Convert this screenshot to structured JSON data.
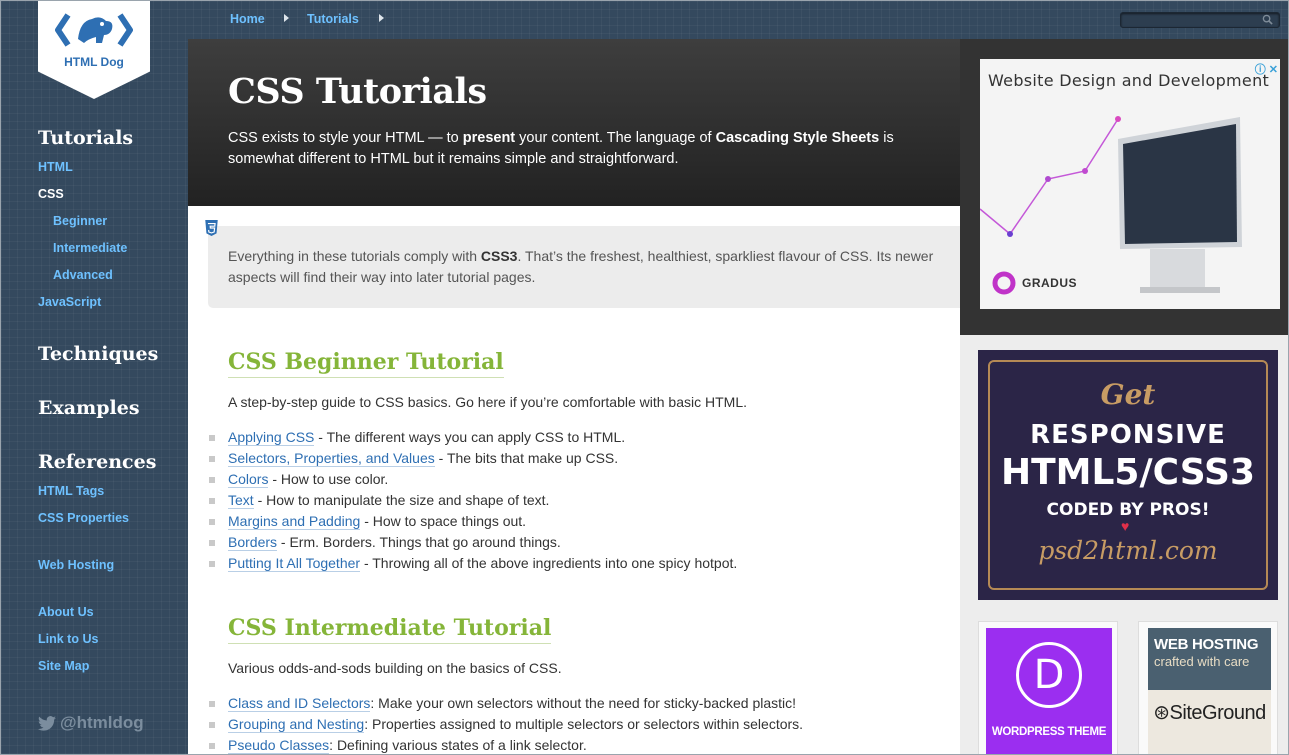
{
  "logo": {
    "text": "HTML Dog"
  },
  "sidebar": {
    "tutorials_heading": "Tutorials",
    "tutorial_links": [
      {
        "label": "HTML"
      },
      {
        "label": "CSS"
      },
      {
        "label": "Beginner"
      },
      {
        "label": "Intermediate"
      },
      {
        "label": "Advanced"
      },
      {
        "label": "JavaScript"
      }
    ],
    "techniques_heading": "Techniques",
    "examples_heading": "Examples",
    "references_heading": "References",
    "reference_links": [
      {
        "label": "HTML Tags"
      },
      {
        "label": "CSS Properties"
      }
    ],
    "web_hosting": "Web Hosting",
    "footer_links": [
      {
        "label": "About Us"
      },
      {
        "label": "Link to Us"
      },
      {
        "label": "Site Map"
      }
    ],
    "twitter": "@htmldog"
  },
  "breadcrumb": {
    "items": [
      "Home",
      "Tutorials"
    ]
  },
  "hero": {
    "title": "CSS Tutorials",
    "desc_1": "CSS exists to style your HTML — to ",
    "desc_b1": "present",
    "desc_2": " your content. The language of ",
    "desc_b2": "Cascading Style Sheets",
    "desc_3": " is somewhat different to HTML but it remains simple and straightforward."
  },
  "notice": {
    "t1": "Everything in these tutorials comply with ",
    "b1": "CSS3",
    "t2": ". That’s the freshest, healthiest, sparkliest flavour of CSS. Its newer aspects will find their way into later tutorial pages."
  },
  "beginner": {
    "title": "CSS Beginner Tutorial",
    "desc": "A step-by-step guide to CSS basics. Go here if you’re comfortable with basic HTML.",
    "items": [
      {
        "link": "Applying CSS",
        "text": " - The different ways you can apply CSS to HTML."
      },
      {
        "link": "Selectors, Properties, and Values",
        "text": " - The bits that make up CSS."
      },
      {
        "link": "Colors",
        "text": " - How to use color."
      },
      {
        "link": "Text",
        "text": " - How to manipulate the size and shape of text."
      },
      {
        "link": "Margins and Padding",
        "text": " - How to space things out."
      },
      {
        "link": "Borders",
        "text": " - Erm. Borders. Things that go around things."
      },
      {
        "link": "Putting It All Together",
        "text": " - Throwing all of the above ingredients into one spicy hotpot."
      }
    ]
  },
  "intermediate": {
    "title": "CSS Intermediate Tutorial",
    "desc": "Various odds-and-sods building on the basics of CSS.",
    "items": [
      {
        "link": "Class and ID Selectors",
        "text": ": Make your own selectors without the need for sticky-backed plastic!"
      },
      {
        "link": "Grouping and Nesting",
        "text": ": Properties assigned to multiple selectors or selectors within selectors."
      },
      {
        "link": "Pseudo Classes",
        "text": ": Defining various states of a link selector."
      }
    ]
  },
  "ads": {
    "ad1_title": "Website Design and Development",
    "ad1_brand": "GRADUS",
    "ad2_get": "Get",
    "ad2_line1": "RESPONSIVE",
    "ad2_line2": "HTML5/CSS3",
    "ad2_line3": "CODED BY PROS!",
    "ad2_site": "psd2html.com",
    "ad3_letter": "D",
    "ad3_label": "WORDPRESS THEME",
    "ad4_line1": "WEB HOSTING",
    "ad4_line2": "crafted with care",
    "ad4_brand": "SiteGround"
  },
  "colors": {
    "sidebar_bg": "#34495e",
    "link": "#6ec1ff",
    "heading_green": "#85b539",
    "content_link": "#2e6fb3"
  }
}
